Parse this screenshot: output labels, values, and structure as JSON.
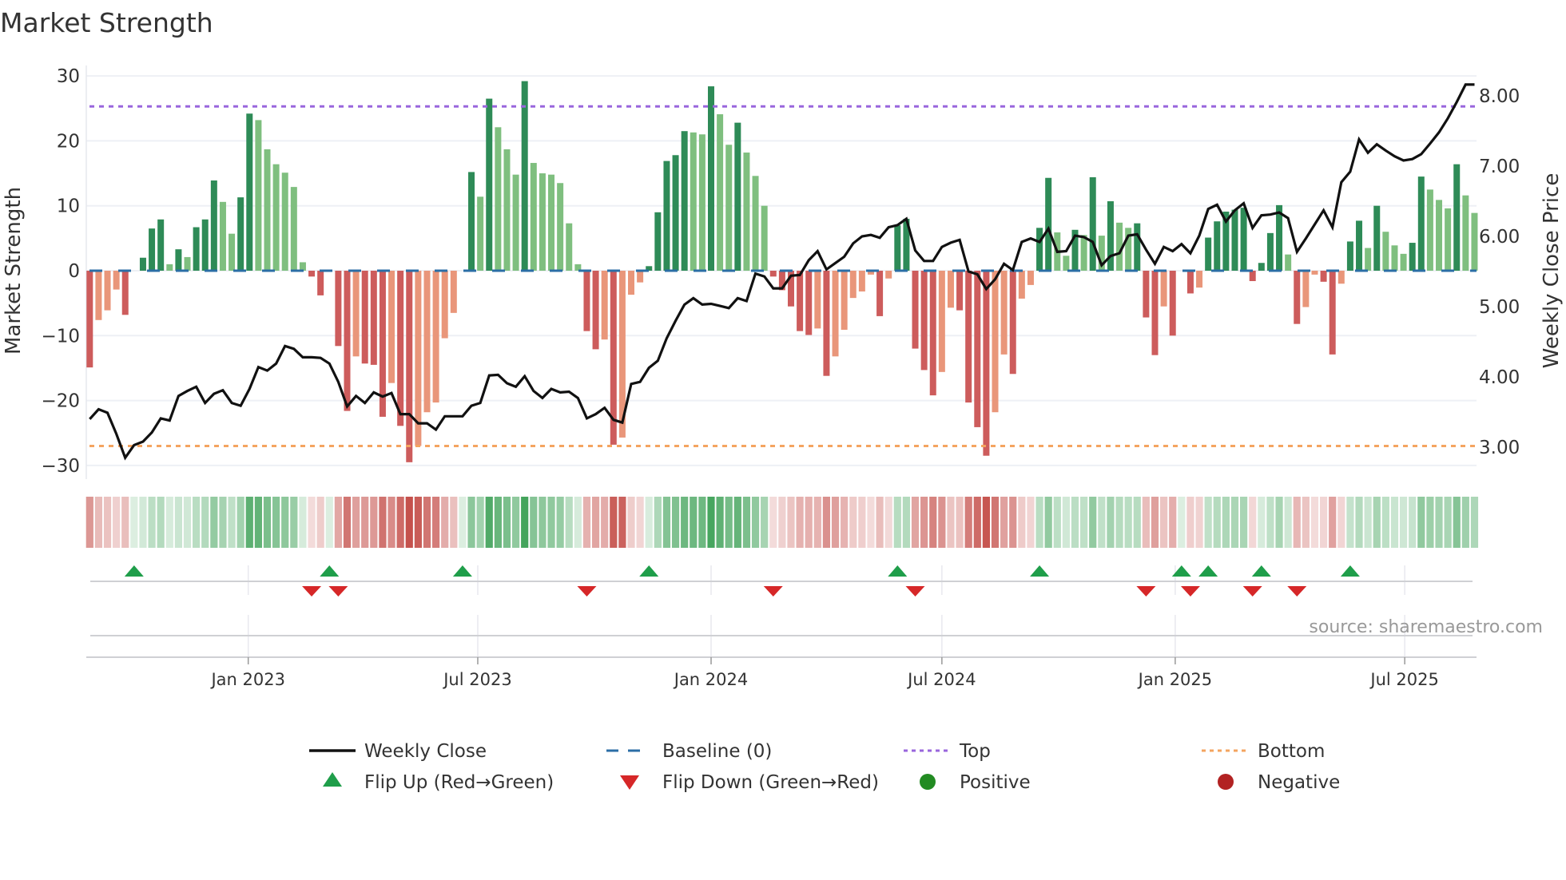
{
  "title": "Market Strength",
  "source": "source: sharemaestro.com",
  "legend": {
    "weekly_close": "Weekly Close",
    "baseline": "Baseline (0)",
    "top": "Top",
    "bottom": "Bottom",
    "flip_up": "Flip Up (Red→Green)",
    "flip_down": "Flip Down (Green→Red)",
    "positive": "Positive",
    "negative": "Negative"
  },
  "colors": {
    "pos_rising": "#2e8b57",
    "pos_falling": "#7fbf7f",
    "neg_falling": "#cd5c5c",
    "neg_rising": "#e9967a",
    "baseline": "#2b6ea6",
    "top": "#9966dd",
    "bottom": "#f4a460",
    "flip_up": "#1f9e4a",
    "flip_down": "#d62728",
    "positive": "#228b22",
    "negative": "#b22222",
    "line": "#111111"
  },
  "chart_data": {
    "type": "bar",
    "title": "Market Strength",
    "ylabel": "Market Strength",
    "ylabel_right": "Weekly Close Price",
    "xlabel": "",
    "ylim": [
      -32,
      31.5
    ],
    "ylim_right": [
      2.73,
      8.27
    ],
    "grid": true,
    "legend_position": "bottom",
    "start_date": "2022-08-29",
    "frequency": "weekly",
    "yticks": [
      {
        "value": 30,
        "label": "30"
      },
      {
        "value": 20,
        "label": "20"
      },
      {
        "value": 10,
        "label": "10"
      },
      {
        "value": 0,
        "label": "0"
      },
      {
        "value": -10,
        "label": "−10"
      },
      {
        "value": -20,
        "label": "−20"
      },
      {
        "value": -30,
        "label": "−30"
      }
    ],
    "yticks_right": [
      {
        "value": 8,
        "label": "8.00"
      },
      {
        "value": 7,
        "label": "7.00"
      },
      {
        "value": 6,
        "label": "6.00"
      },
      {
        "value": 5,
        "label": "5.00"
      },
      {
        "value": 4,
        "label": "4.00"
      },
      {
        "value": 3,
        "label": "3.00"
      }
    ],
    "xticks": [
      {
        "date": "2023-01-01",
        "label": "Jan 2023"
      },
      {
        "date": "2023-07-01",
        "label": "Jul 2023"
      },
      {
        "date": "2024-01-01",
        "label": "Jan 2024"
      },
      {
        "date": "2024-07-01",
        "label": "Jul 2024"
      },
      {
        "date": "2025-01-01",
        "label": "Jan 2025"
      },
      {
        "date": "2025-07-01",
        "label": "Jul 2025"
      }
    ],
    "top_level": 25.3,
    "bottom_level": -27,
    "baseline": 0,
    "strength": [
      -14.9,
      -7.6,
      -6.1,
      -2.9,
      -6.8,
      0,
      2.0,
      6.5,
      7.9,
      1.0,
      3.3,
      2.1,
      6.7,
      7.9,
      13.9,
      10.6,
      5.7,
      11.3,
      24.2,
      23.2,
      18.7,
      16.4,
      15.1,
      12.9,
      1.3,
      -0.9,
      -3.8,
      0,
      -11.6,
      -21.6,
      -13.2,
      -14.3,
      -14.5,
      -22.5,
      -17.3,
      -23.9,
      -29.5,
      -27.0,
      -21.8,
      -20.3,
      -10.4,
      -6.5,
      0,
      15.2,
      11.4,
      26.5,
      22.1,
      18.7,
      14.8,
      29.2,
      16.6,
      15.0,
      14.8,
      13.5,
      7.3,
      1.0,
      -9.3,
      -12.1,
      -10.6,
      -26.8,
      -25.7,
      -3.7,
      -1.8,
      0.7,
      9.0,
      16.9,
      17.8,
      21.5,
      21.3,
      21.0,
      28.4,
      24.1,
      19.4,
      22.8,
      18.2,
      14.6,
      10.0,
      -0.9,
      -3.0,
      -5.5,
      -9.3,
      -9.9,
      -8.9,
      -16.2,
      -13.2,
      -9.1,
      -4.2,
      -3.2,
      -0.6,
      -7.0,
      -1.2,
      7.0,
      8.0,
      -12.0,
      -15.3,
      -19.2,
      -15.6,
      -5.7,
      -6.1,
      -20.3,
      -24.1,
      -28.5,
      -21.8,
      -12.9,
      -15.9,
      -4.3,
      -2.2,
      6.6,
      14.3,
      5.9,
      2.3,
      6.3,
      5.5,
      14.4,
      5.4,
      10.7,
      7.4,
      6.6,
      7.3,
      -7.2,
      -13.0,
      -5.5,
      -10.0,
      0,
      -3.5,
      -2.6,
      5.1,
      7.6,
      9.1,
      9.4,
      9.7,
      -1.6,
      1.2,
      5.8,
      10.1,
      2.5,
      -8.2,
      -5.6,
      -0.6,
      -1.7,
      -12.9,
      -2.0,
      4.5,
      7.7,
      3.5,
      10.0,
      6.0,
      3.9,
      2.6,
      4.3,
      14.5,
      12.5,
      10.9,
      9.6,
      16.4,
      11.6,
      8.9
    ],
    "weekly_close": [
      3.4,
      3.54,
      3.49,
      3.19,
      2.85,
      3.03,
      3.08,
      3.21,
      3.41,
      3.38,
      3.73,
      3.8,
      3.86,
      3.63,
      3.76,
      3.81,
      3.63,
      3.59,
      3.83,
      4.14,
      4.09,
      4.19,
      4.44,
      4.4,
      4.28,
      4.28,
      4.27,
      4.19,
      3.93,
      3.58,
      3.73,
      3.63,
      3.78,
      3.72,
      3.77,
      3.47,
      3.47,
      3.34,
      3.34,
      3.25,
      3.44,
      3.44,
      3.44,
      3.59,
      3.63,
      4.02,
      4.03,
      3.91,
      3.86,
      4.01,
      3.8,
      3.7,
      3.83,
      3.78,
      3.79,
      3.7,
      3.41,
      3.47,
      3.56,
      3.39,
      3.35,
      3.9,
      3.93,
      4.13,
      4.23,
      4.55,
      4.8,
      5.03,
      5.12,
      5.03,
      5.04,
      5.01,
      4.98,
      5.12,
      5.08,
      5.47,
      5.43,
      5.26,
      5.26,
      5.44,
      5.45,
      5.66,
      5.79,
      5.53,
      5.62,
      5.71,
      5.9,
      6.0,
      6.02,
      5.98,
      6.13,
      6.16,
      6.25,
      5.8,
      5.65,
      5.65,
      5.85,
      5.91,
      5.95,
      5.5,
      5.46,
      5.25,
      5.39,
      5.61,
      5.52,
      5.92,
      5.97,
      5.92,
      6.11,
      5.78,
      5.79,
      6.01,
      5.99,
      5.92,
      5.59,
      5.72,
      5.76,
      6.01,
      6.03,
      5.81,
      5.61,
      5.85,
      5.79,
      5.89,
      5.76,
      6.01,
      6.39,
      6.45,
      6.21,
      6.37,
      6.47,
      6.12,
      6.3,
      6.31,
      6.34,
      6.26,
      5.78,
      5.97,
      6.17,
      6.37,
      6.13,
      6.77,
      6.92,
      7.38,
      7.19,
      7.31,
      7.22,
      7.14,
      7.08,
      7.1,
      7.17,
      7.32,
      7.48,
      7.68,
      7.91,
      8.16,
      8.16
    ]
  }
}
